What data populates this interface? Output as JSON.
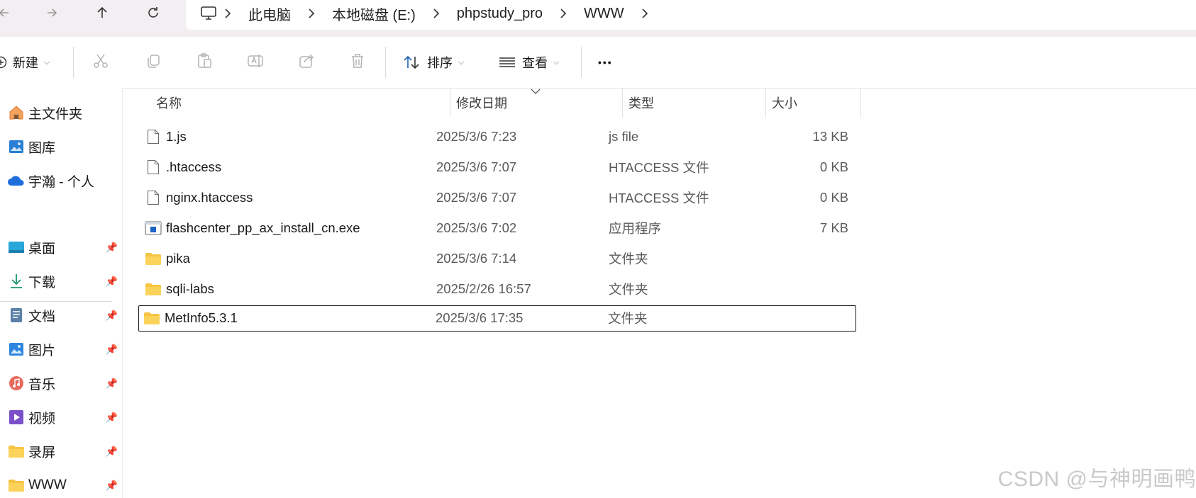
{
  "breadcrumb": [
    "此电脑",
    "本地磁盘 (E:)",
    "phpstudy_pro",
    "WWW"
  ],
  "toolbar": {
    "new_label": "新建",
    "sort_label": "排序",
    "view_label": "查看",
    "more_label": "•••"
  },
  "sidebar": {
    "items": [
      {
        "label": "主文件夹",
        "icon": "home-icon"
      },
      {
        "label": "图库",
        "icon": "gallery-icon"
      },
      {
        "label": "宇瀚 - 个人",
        "icon": "onedrive-cloud-icon"
      }
    ],
    "pinned": [
      {
        "label": "桌面",
        "icon": "desktop-icon"
      },
      {
        "label": "下载",
        "icon": "download-icon"
      },
      {
        "label": "文档",
        "icon": "documents-icon"
      },
      {
        "label": "图片",
        "icon": "pictures-icon"
      },
      {
        "label": "音乐",
        "icon": "music-icon"
      },
      {
        "label": "视频",
        "icon": "videos-icon"
      },
      {
        "label": "录屏",
        "icon": "folder-icon"
      },
      {
        "label": "WWW",
        "icon": "folder-icon"
      }
    ]
  },
  "columns": {
    "name": "名称",
    "date": "修改日期",
    "type": "类型",
    "size": "大小"
  },
  "files": [
    {
      "name": "1.js",
      "date": "2025/3/6 7:23",
      "type": "js file",
      "size": "13 KB",
      "icon": "file-icon"
    },
    {
      "name": ".htaccess",
      "date": "2025/3/6 7:07",
      "type": "HTACCESS 文件",
      "size": "0 KB",
      "icon": "file-icon"
    },
    {
      "name": "nginx.htaccess",
      "date": "2025/3/6 7:07",
      "type": "HTACCESS 文件",
      "size": "0 KB",
      "icon": "file-icon"
    },
    {
      "name": "flashcenter_pp_ax_install_cn.exe",
      "date": "2025/3/6 7:02",
      "type": "应用程序",
      "size": "7 KB",
      "icon": "exe-icon"
    },
    {
      "name": "pika",
      "date": "2025/3/6 7:14",
      "type": "文件夹",
      "size": "",
      "icon": "folder-icon"
    },
    {
      "name": "sqli-labs",
      "date": "2025/2/26 16:57",
      "type": "文件夹",
      "size": "",
      "icon": "folder-icon"
    },
    {
      "name": "MetInfo5.3.1",
      "date": "2025/3/6 17:35",
      "type": "文件夹",
      "size": "",
      "icon": "folder-icon"
    }
  ],
  "watermark": "CSDN @与神明画鸭",
  "colors": {
    "titlebar_bg": "#f3eef1",
    "folder_yellow": "#f6c444",
    "selection_border": "#1a1a1a"
  }
}
